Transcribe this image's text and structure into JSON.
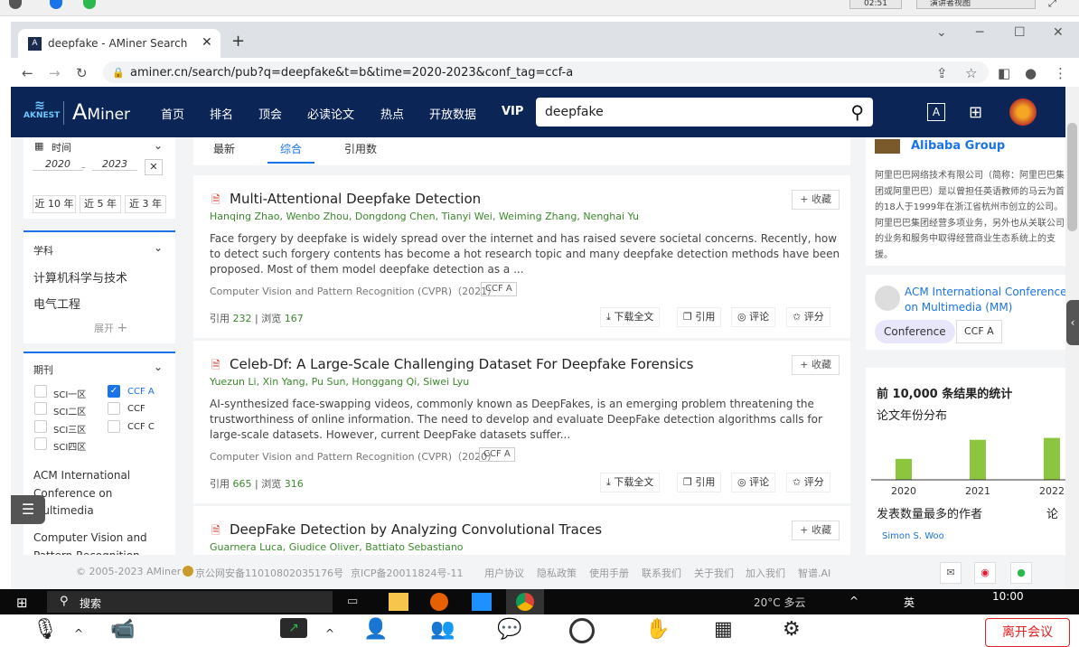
{
  "top_strip": {
    "time": "02:51",
    "view": "演讲者视图"
  },
  "browser": {
    "tab_title": "deepfake - AMiner Search",
    "url": "aminer.cn/search/pub?q=deepfake&t=b&time=2020-2023&conf_tag=ccf-a"
  },
  "header": {
    "logo_small": "AKNEST",
    "logo_brand": "Miner",
    "menu": [
      "首页",
      "排名",
      "顶会",
      "必读论文",
      "热点",
      "开放数据",
      "VIP"
    ],
    "search_value": "deepfake"
  },
  "sidebar": {
    "time": {
      "label": "时间",
      "from": "2020",
      "to": "2023",
      "ranges": [
        "近 10 年",
        "近 5 年",
        "近 3 年"
      ]
    },
    "subject": {
      "label": "学科",
      "items": [
        "计算机科学与技术",
        "电气工程"
      ],
      "expand": "展开"
    },
    "journal": {
      "label": "期刊",
      "options": [
        {
          "label": "SCI一区",
          "checked": false
        },
        {
          "label": "CCF A",
          "checked": true
        },
        {
          "label": "SCI二区",
          "checked": false
        },
        {
          "label": "CCF",
          "checked": false
        },
        {
          "label": "SCI三区",
          "checked": false
        },
        {
          "label": "CCF C",
          "checked": false
        },
        {
          "label": "SCI四区",
          "checked": false
        }
      ],
      "venues": [
        "ACM International Conference on Multimedia",
        "Computer Vision and Pattern Recognition"
      ]
    }
  },
  "sort_tabs": [
    "最新",
    "综合",
    "引用数"
  ],
  "active_sort": "综合",
  "papers": [
    {
      "title": "Multi-Attentional Deepfake Detection",
      "authors": [
        "Hanqing Zhao",
        "Wenbo Zhou",
        "Dongdong Chen",
        "Tianyi Wei",
        "Weiming Zhang",
        "Nenghai Yu"
      ],
      "abstract": "Face forgery by deepfake is widely spread over the internet and has raised severe societal concerns. Recently, how to detect such forgery contents has become a hot research topic and many deepfake detection methods have been proposed. Most of them model deepfake detection as a ...",
      "venue": "Computer Vision and Pattern Recognition (CVPR)（2021）",
      "ccf": "CCF A",
      "cite_label": "引用",
      "cites": "232",
      "view_label": "浏览",
      "views": "167"
    },
    {
      "title": "Celeb-Df: A Large-Scale Challenging Dataset For Deepfake Forensics",
      "authors": [
        "Yuezun Li",
        "Xin Yang",
        "Pu Sun",
        "Honggang Qi",
        "Siwei Lyu"
      ],
      "abstract": "AI-synthesized face-swapping videos, commonly known as DeepFakes, is an emerging problem threatening the trustworthiness of online information. The need to develop and evaluate DeepFake detection algorithms calls for large-scale datasets. However, current DeepFake datasets suffer...",
      "venue": "Computer Vision and Pattern Recognition (CVPR)（2020）",
      "ccf": "CCF A",
      "cite_label": "引用",
      "cites": "665",
      "view_label": "浏览",
      "views": "316"
    },
    {
      "title": "DeepFake Detection by Analyzing Convolutional Traces",
      "authors": [
        "Guarnera Luca",
        "Giudice Oliver",
        "Battiato Sebastiano"
      ]
    }
  ],
  "paper_actions": {
    "download": "下载全文",
    "cite": "引用",
    "comment": "评论",
    "rate": "评分",
    "favorite": "收藏"
  },
  "right": {
    "org_name": "Alibaba Group",
    "org_desc": "阿里巴巴网络技术有限公司（简称：阿里巴巴集团或阿里巴巴）是以曾担任英语教师的马云为首的18人于1999年在浙江省杭州市创立的公司。阿里巴巴集团经营多项业务，另外也从关联公司的业务和服务中取得经营商业生态系统上的支援。",
    "conf_name": "ACM International Conference on Multimedia (MM)",
    "conf_type": "Conference",
    "conf_ccf": "CCF A",
    "stats_title": "前 10,000 条结果的统计",
    "stats_sub": "论文年份分布",
    "top_authors_title": "发表数量最多的作者",
    "top_authors_more": "论",
    "top_author": "Simon S. Woo"
  },
  "chart_data": {
    "type": "bar",
    "categories": [
      "2020",
      "2021",
      "2022"
    ],
    "values": [
      22,
      42,
      44
    ],
    "title": "论文年份分布",
    "xlabel": "",
    "ylabel": "",
    "ylim": [
      0,
      55
    ],
    "colors": [
      "#8cc63f"
    ]
  },
  "footer": {
    "copyright": "© 2005-2023 AMiner",
    "beian": "京公网安备11010802035176号",
    "icp": "京ICP备20011824号-11",
    "links": [
      "用户协议",
      "隐私政策",
      "使用手册",
      "联系我们",
      "关于我们",
      "加入我们",
      "智谱.AI"
    ]
  },
  "taskbar": {
    "search": "搜索",
    "weather": "20°C 多云",
    "lang": "英",
    "clock": "10:00"
  },
  "zoom": {
    "leave": "离开会议"
  }
}
